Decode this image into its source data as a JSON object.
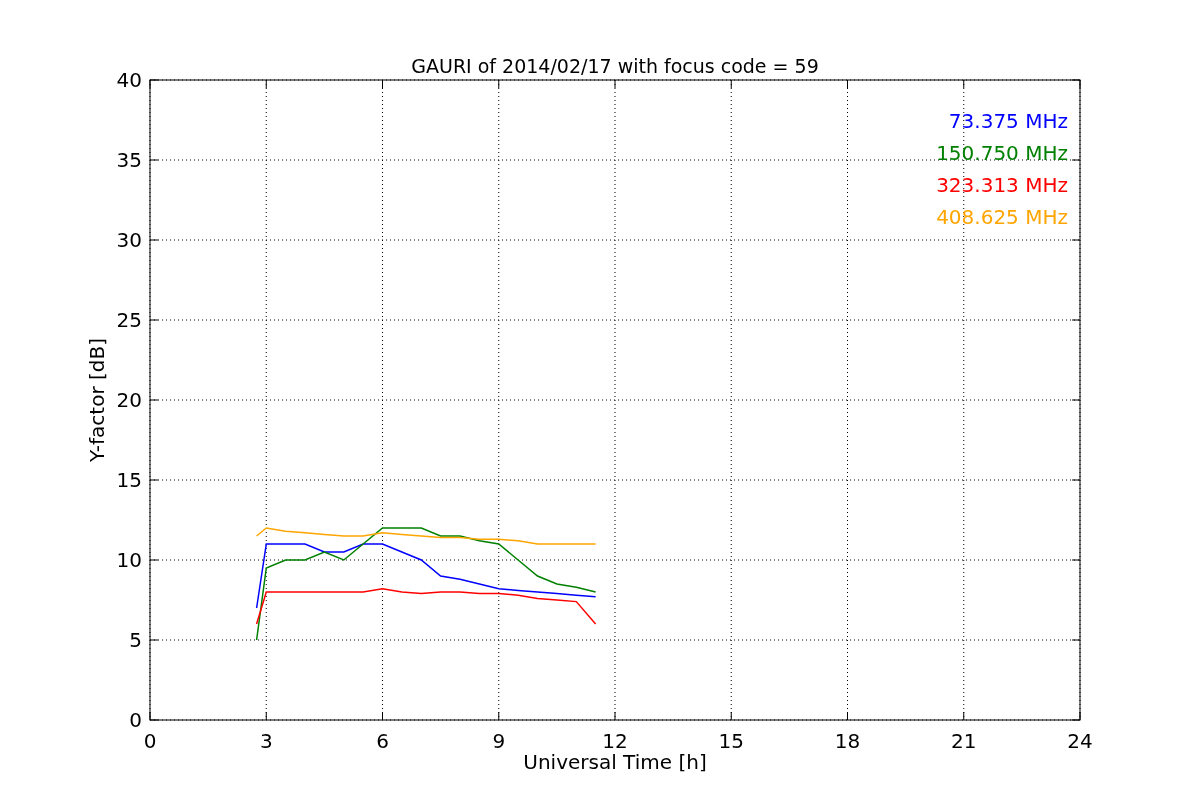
{
  "chart_data": {
    "type": "line",
    "title": "GAURI of 2014/02/17 with focus code = 59",
    "xlabel": "Universal Time [h]",
    "ylabel": "Y-factor [dB]",
    "x": [
      2.75,
      3,
      3.5,
      4,
      4.5,
      5,
      5.5,
      6,
      6.5,
      7,
      7.5,
      8,
      8.5,
      9,
      9.5,
      10,
      10.5,
      11,
      11.5
    ],
    "series": [
      {
        "name": "73.375 MHz",
        "color": "#0000ff",
        "values": [
          7,
          11,
          11,
          11,
          10.5,
          10.5,
          11,
          11,
          10.5,
          10,
          9,
          8.8,
          8.5,
          8.2,
          8.1,
          8,
          7.9,
          7.8,
          7.7
        ]
      },
      {
        "name": "150.750 MHz",
        "color": "#008000",
        "values": [
          5,
          9.5,
          10,
          10,
          10.5,
          10,
          11,
          12,
          12,
          12,
          11.5,
          11.5,
          11.2,
          11,
          10,
          9,
          8.5,
          8.3,
          8
        ]
      },
      {
        "name": "323.313 MHz",
        "color": "#ff0000",
        "values": [
          6,
          8,
          8,
          8,
          8,
          8,
          8,
          8.2,
          8,
          7.9,
          8,
          8,
          7.9,
          7.9,
          7.8,
          7.6,
          7.5,
          7.4,
          6
        ]
      },
      {
        "name": "408.625 MHz",
        "color": "#ffa500",
        "values": [
          11.5,
          12,
          11.8,
          11.7,
          11.6,
          11.5,
          11.5,
          11.7,
          11.6,
          11.5,
          11.4,
          11.4,
          11.3,
          11.3,
          11.2,
          11,
          11,
          11,
          11
        ]
      }
    ],
    "xlim": [
      0,
      24
    ],
    "ylim": [
      0,
      40
    ],
    "xticks": [
      0,
      3,
      6,
      9,
      12,
      15,
      18,
      21,
      24
    ],
    "yticks": [
      0,
      5,
      10,
      15,
      20,
      25,
      30,
      35,
      40
    ],
    "grid": true
  }
}
